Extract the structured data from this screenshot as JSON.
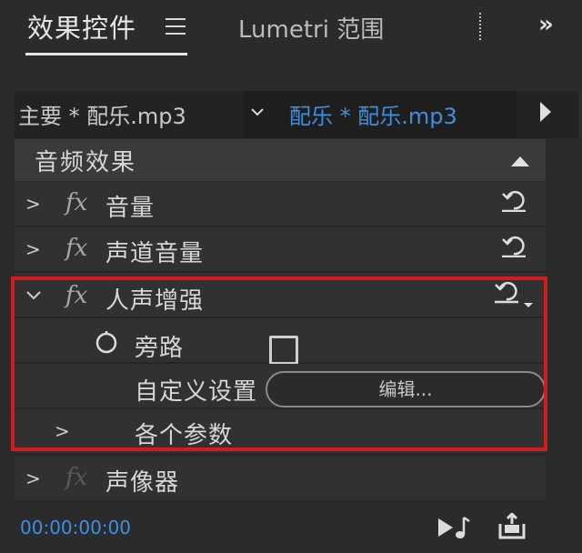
{
  "tabs": {
    "active_label": "效果控件",
    "second_label": "Lumetri 范围",
    "overflow_glyph": "»"
  },
  "clips": {
    "master_label": "主要 * 配乐.mp3",
    "active_label": "配乐 * 配乐.mp3"
  },
  "section": {
    "title": "音频效果"
  },
  "effects": [
    {
      "name": "音量",
      "expanded": false
    },
    {
      "name": "声道音量",
      "expanded": false
    },
    {
      "name": "人声增强",
      "expanded": true
    },
    {
      "name": "声像器",
      "expanded": false
    }
  ],
  "params": {
    "bypass_label": "旁路",
    "bypass_checked": false,
    "custom_label": "自定义设置",
    "edit_button_label": "编辑...",
    "each_param_label": "各个参数"
  },
  "footer": {
    "timecode": "00:00:00:00"
  },
  "colors": {
    "accent": "#3d8fe0",
    "highlight": "#d11d1d",
    "panel": "#2b2b2b"
  }
}
